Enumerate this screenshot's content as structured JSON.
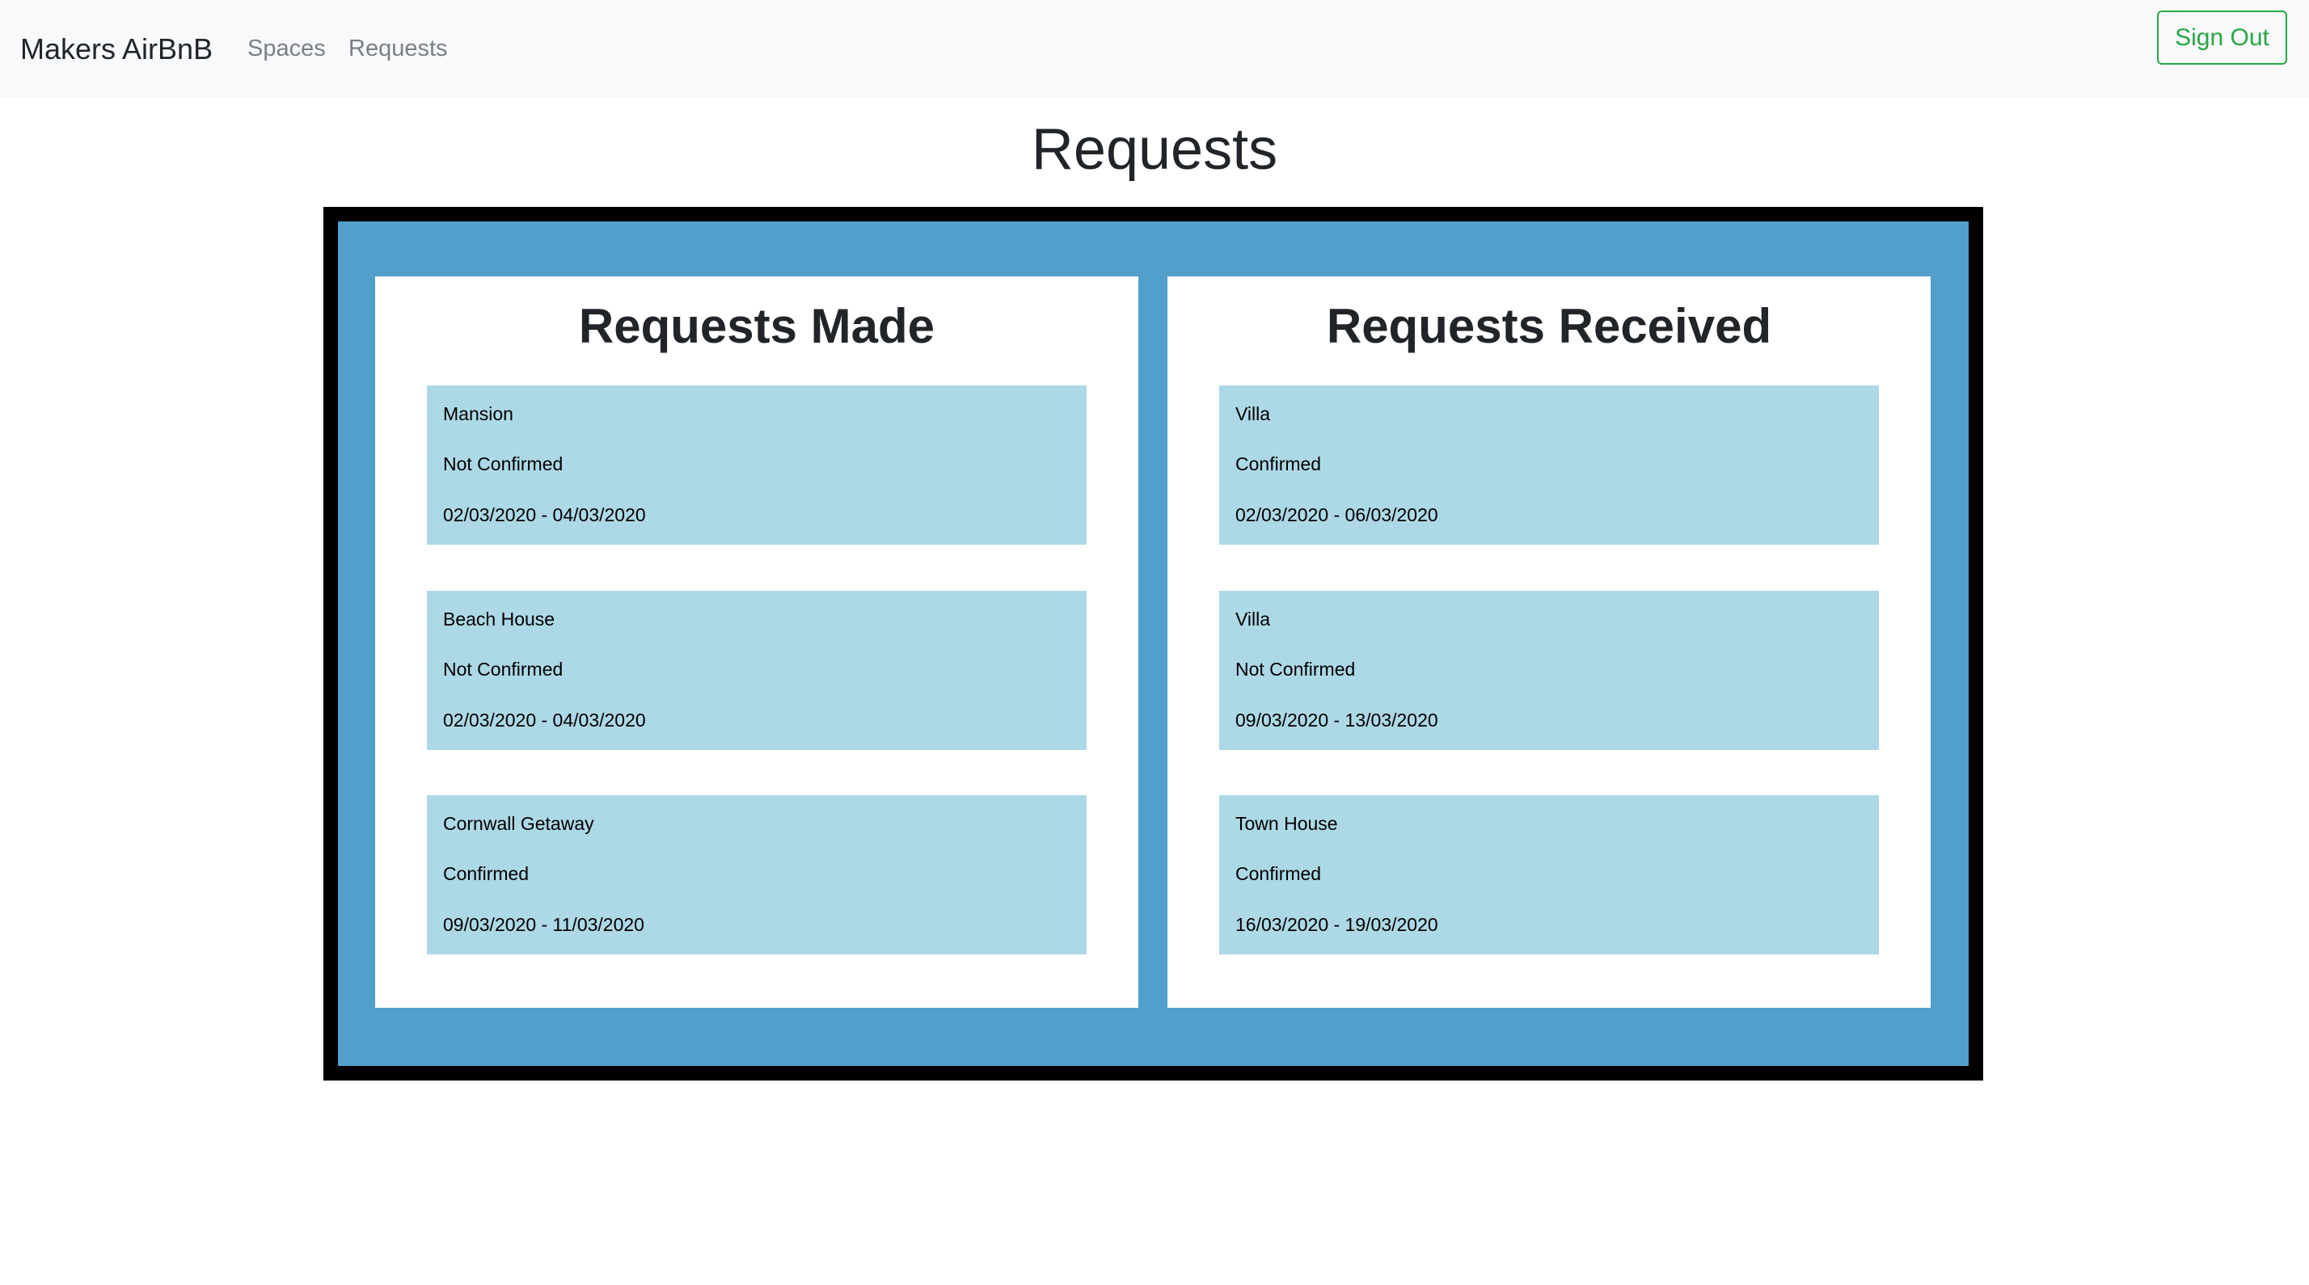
{
  "navbar": {
    "brand": "Makers AirBnB",
    "links": [
      {
        "label": "Spaces"
      },
      {
        "label": "Requests"
      }
    ],
    "sign_out_label": "Sign Out"
  },
  "page": {
    "title": "Requests"
  },
  "requests_made": {
    "title": "Requests Made",
    "items": [
      {
        "space": "Mansion",
        "status": "Not Confirmed",
        "dates": "02/03/2020 - 04/03/2020"
      },
      {
        "space": "Beach House",
        "status": "Not Confirmed",
        "dates": "02/03/2020 - 04/03/2020"
      },
      {
        "space": "Cornwall Getaway",
        "status": "Confirmed",
        "dates": "09/03/2020 - 11/03/2020"
      }
    ]
  },
  "requests_received": {
    "title": "Requests Received",
    "items": [
      {
        "space": "Villa",
        "status": "Confirmed",
        "dates": "02/03/2020 - 06/03/2020"
      },
      {
        "space": "Villa",
        "status": "Not Confirmed",
        "dates": "09/03/2020 - 13/03/2020"
      },
      {
        "space": "Town House",
        "status": "Confirmed",
        "dates": "16/03/2020 - 19/03/2020"
      }
    ]
  },
  "colors": {
    "navbar_bg": "#f8f9fa",
    "frame": "#000000",
    "panel": "#519fca",
    "card": "#add8e6",
    "sign_out": "#28a745"
  }
}
